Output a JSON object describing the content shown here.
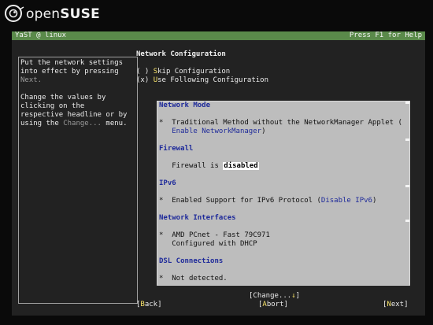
{
  "logo": {
    "prefix": "open",
    "brand": "SUSE",
    "icon": "chameleon-icon"
  },
  "window": {
    "title": "YaST @ linux",
    "help_hint": "Press F1 for Help"
  },
  "help": {
    "lines": [
      "Put the network settings",
      "into effect by pressing",
      "",
      "",
      "Change the values by",
      "clicking on the",
      "respective headline or by",
      "using the"
    ],
    "next_word": "Next.",
    "change_word": "Change...",
    "menu_word": " menu."
  },
  "dialog": {
    "title": "Network Configuration",
    "skip_option": {
      "mark": "( )",
      "hot": "S",
      "rest": "kip Configuration"
    },
    "use_option": {
      "mark": "(x)",
      "hot": "U",
      "rest": "se Following Configuration"
    }
  },
  "overview": {
    "network_mode": {
      "heading": "Network Mode",
      "bullet": "*",
      "text": "Traditional Method without the NetworkManager Applet (",
      "link": "Enable NetworkManager",
      "close": ")"
    },
    "firewall": {
      "heading": "Firewall",
      "text": "Firewall is ",
      "status": "disabled"
    },
    "ipv6": {
      "heading": "IPv6",
      "bullet": "*",
      "text": "Enabled Support for IPv6 Protocol (",
      "link": "Disable IPv6",
      "close": ")"
    },
    "interfaces": {
      "heading": "Network Interfaces",
      "bullet": "*",
      "name": "AMD PCnet - Fast 79C971",
      "detail": "Configured with DHCP"
    },
    "dsl": {
      "heading": "DSL Connections",
      "bullet": "*",
      "text": "Not detected."
    }
  },
  "buttons": {
    "change": {
      "open": "[",
      "label": "Change...",
      "arrow": "↓",
      "close": "]"
    },
    "back": {
      "open": "[",
      "hot": "B",
      "rest": "ack",
      "close": "]"
    },
    "abort": {
      "open": "[",
      "hot": "A",
      "rest": "bort",
      "close": "]"
    },
    "next": {
      "open": "[",
      "hot": "N",
      "rest": "ext",
      "close": "]"
    }
  }
}
